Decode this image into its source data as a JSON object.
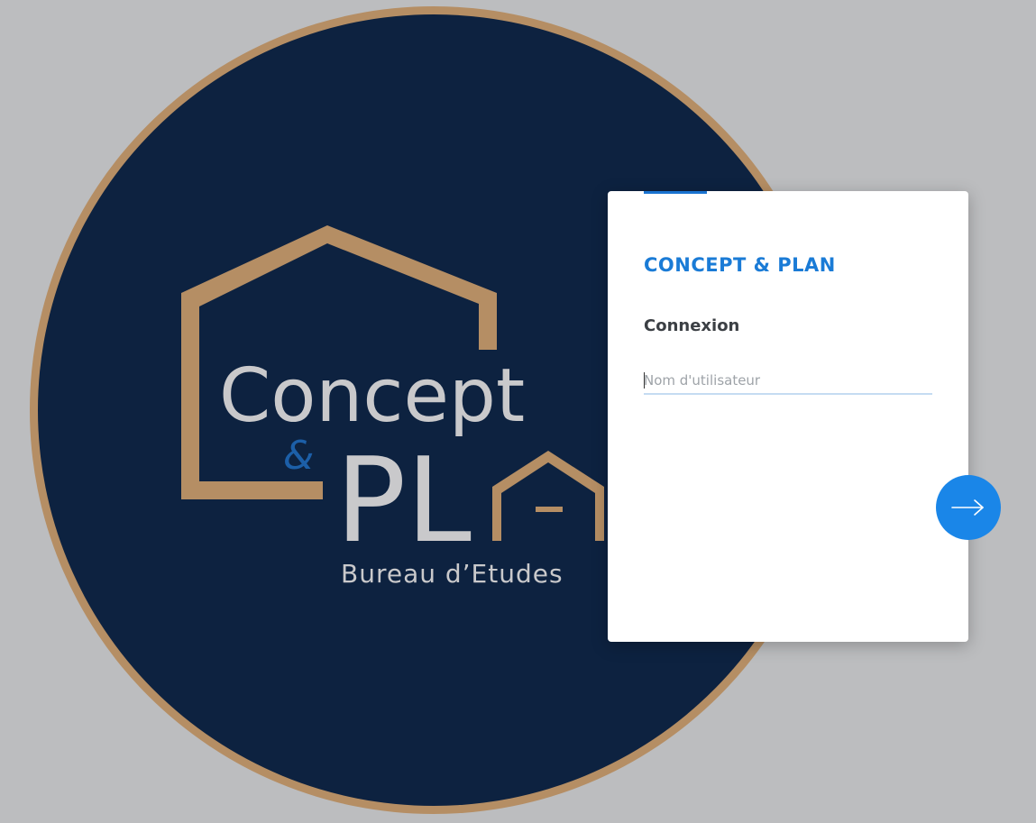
{
  "logo": {
    "line1": "Concept",
    "ampersand": "&",
    "line2": "PL",
    "tagline": "Bureau  d’Etudes"
  },
  "login": {
    "brand_title": "CONCEPT & PLAN",
    "heading": "Connexion",
    "username_placeholder": "Nom d'utilisateur",
    "username_value": "",
    "submit_icon": "arrow-right-icon"
  },
  "colors": {
    "accent": "#1a7bd6",
    "button": "#1a86e8",
    "logo_navy": "#0d2240",
    "logo_gold": "#b58e64",
    "page_bg": "#bcbdbf"
  }
}
